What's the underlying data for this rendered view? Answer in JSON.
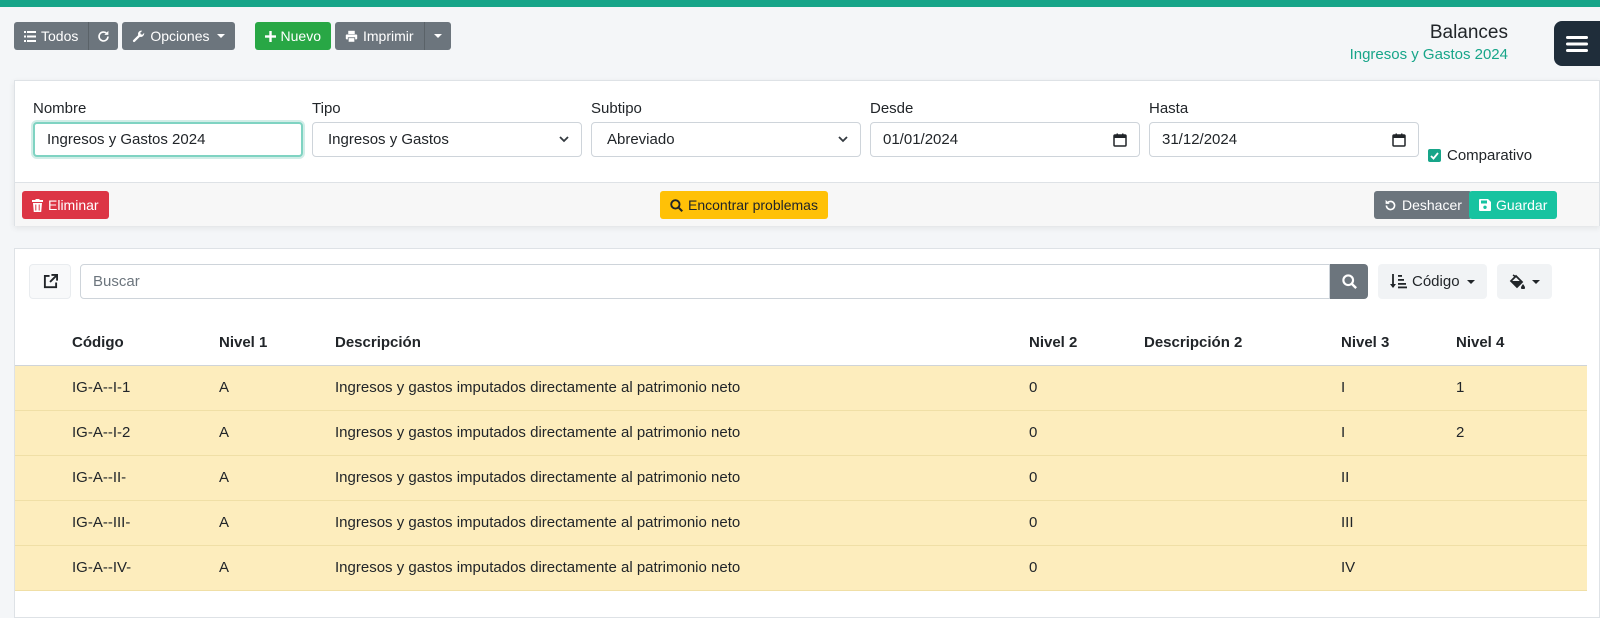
{
  "toolbar": {
    "todos_label": "Todos",
    "opciones_label": "Opciones",
    "nuevo_label": "Nuevo",
    "imprimir_label": "Imprimir"
  },
  "header": {
    "title": "Balances",
    "subtitle": "Ingresos y Gastos 2024"
  },
  "form": {
    "nombre_label": "Nombre",
    "nombre_value": "Ingresos y Gastos 2024",
    "tipo_label": "Tipo",
    "tipo_value": "Ingresos y Gastos",
    "subtipo_label": "Subtipo",
    "subtipo_value": "Abreviado",
    "desde_label": "Desde",
    "desde_value": "01/01/2024",
    "hasta_label": "Hasta",
    "hasta_value": "31/12/2024",
    "comparativo_label": "Comparativo",
    "comparativo_checked": true
  },
  "actions": {
    "eliminar_label": "Eliminar",
    "encontrar_label": "Encontrar problemas",
    "deshacer_label": "Deshacer",
    "guardar_label": "Guardar"
  },
  "list": {
    "search_placeholder": "Buscar",
    "sort_label": "Código",
    "columns": [
      "Código",
      "Nivel 1",
      "Descripción",
      "Nivel 2",
      "Descripción 2",
      "Nivel 3",
      "Nivel 4"
    ],
    "rows": [
      [
        "IG-A--I-1",
        "A",
        "Ingresos y gastos imputados directamente al patrimonio neto",
        "0",
        "",
        "I",
        "1"
      ],
      [
        "IG-A--I-2",
        "A",
        "Ingresos y gastos imputados directamente al patrimonio neto",
        "0",
        "",
        "I",
        "2"
      ],
      [
        "IG-A--II-",
        "A",
        "Ingresos y gastos imputados directamente al patrimonio neto",
        "0",
        "",
        "II",
        ""
      ],
      [
        "IG-A--III-",
        "A",
        "Ingresos y gastos imputados directamente al patrimonio neto",
        "0",
        "",
        "III",
        ""
      ],
      [
        "IG-A--IV-",
        "A",
        "Ingresos y gastos imputados directamente al patrimonio neto",
        "0",
        "",
        "IV",
        ""
      ]
    ]
  },
  "colors": {
    "accent": "#17a589",
    "row_highlight": "#fdedbd"
  }
}
